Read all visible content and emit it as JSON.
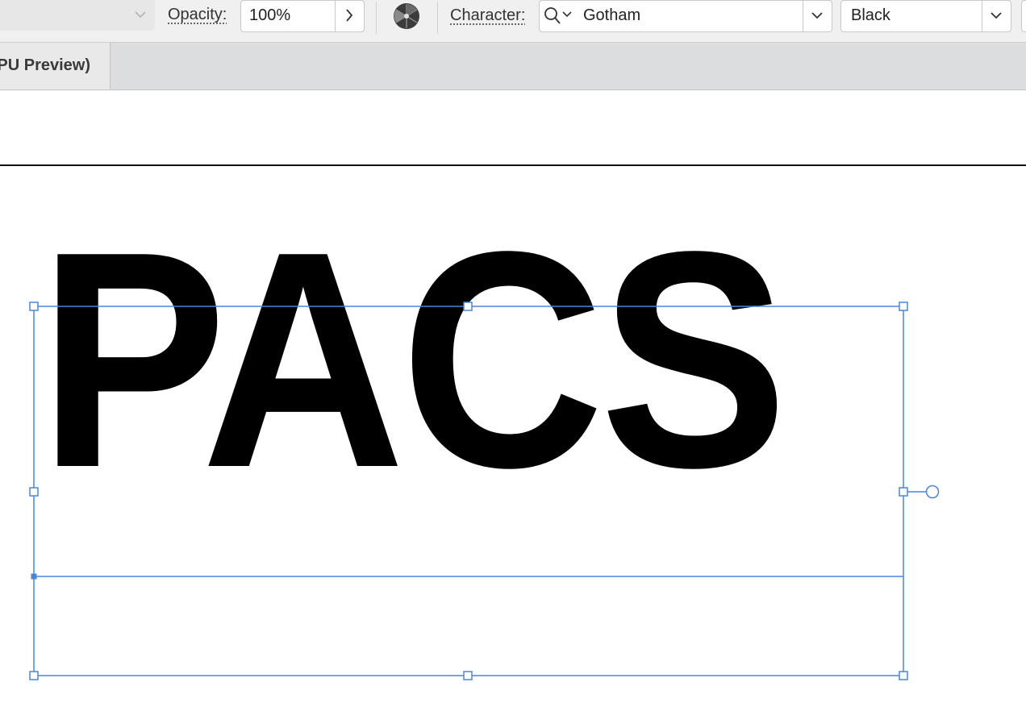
{
  "control_bar": {
    "opacity_label": "Opacity:",
    "opacity_value": "100%",
    "character_label": "Character:",
    "font_family": "Gotham",
    "font_style": "Black"
  },
  "document_tab": {
    "title": "PU Preview)"
  },
  "canvas": {
    "text_content": "PACS"
  },
  "colors": {
    "selection": "#4a86d8",
    "text": "#000000",
    "control_bar_bg": "#f0f0f0",
    "tab_bar_bg": "#dcdddf"
  },
  "icons": [
    "chevron-down-icon",
    "chevron-right-icon",
    "recolor-artwork-icon",
    "search-icon"
  ]
}
